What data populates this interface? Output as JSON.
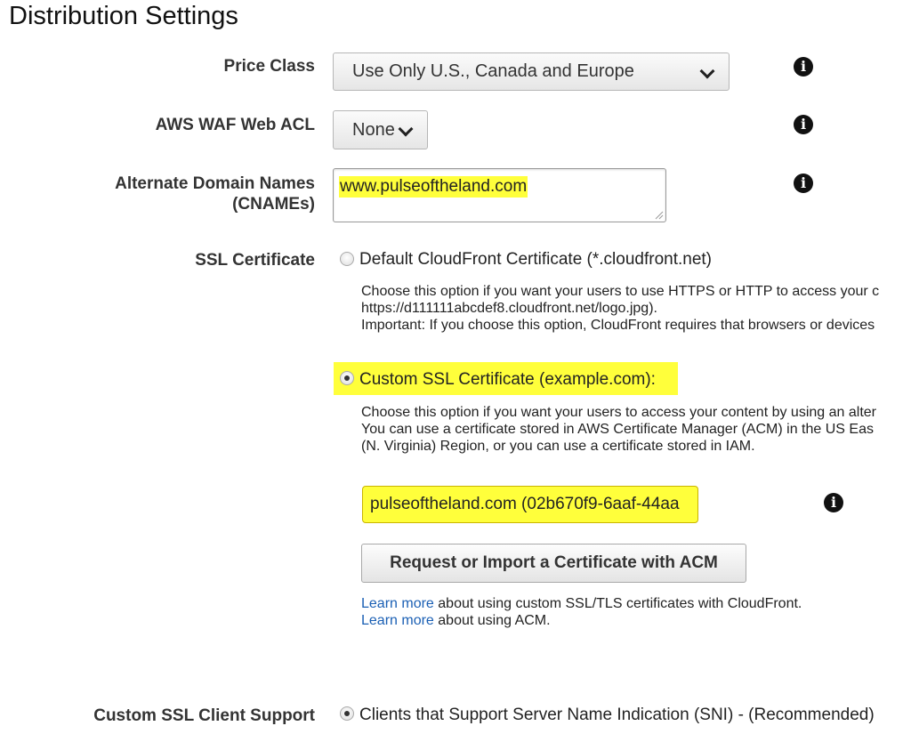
{
  "page_title": "Distribution Settings",
  "price_class": {
    "label": "Price Class",
    "selected": "Use Only U.S., Canada and Europe"
  },
  "waf": {
    "label": "AWS WAF Web ACL",
    "selected": "None"
  },
  "cnames": {
    "label_line1": "Alternate Domain Names",
    "label_line2": "(CNAMEs)",
    "value": "www.pulseoftheland.com"
  },
  "ssl": {
    "label": "SSL Certificate",
    "default_option": {
      "label": "Default CloudFront Certificate (*.cloudfront.net)",
      "desc_line1": "Choose this option if you want your users to use HTTPS or HTTP to access your c",
      "desc_line2": "https://d111111abcdef8.cloudfront.net/logo.jpg).",
      "desc_line3": "Important: If you choose this option, CloudFront requires that browsers or devices"
    },
    "custom_option": {
      "label": "Custom SSL Certificate (example.com):",
      "desc_line1": "Choose this option if you want your users to access your content by using an alter",
      "desc_line2": "You can use a certificate stored in AWS Certificate Manager (ACM) in the US Eas",
      "desc_line3": "(N. Virginia) Region, or you can use a certificate stored in IAM."
    },
    "certificate_value": "pulseoftheland.com (02b670f9-6aaf-44aa",
    "request_button": "Request or Import a Certificate with ACM",
    "learn_more_1": {
      "link": "Learn more",
      "text": " about using custom SSL/TLS certificates with CloudFront."
    },
    "learn_more_2": {
      "link": "Learn more",
      "text": " about using ACM."
    }
  },
  "client_support": {
    "label": "Custom SSL Client Support",
    "option": "Clients that Support Server Name Indication (SNI) - (Recommended)"
  },
  "info_icon_glyph": "i",
  "colors": {
    "highlight": "#ffff3b",
    "link": "#1a5fb4"
  }
}
